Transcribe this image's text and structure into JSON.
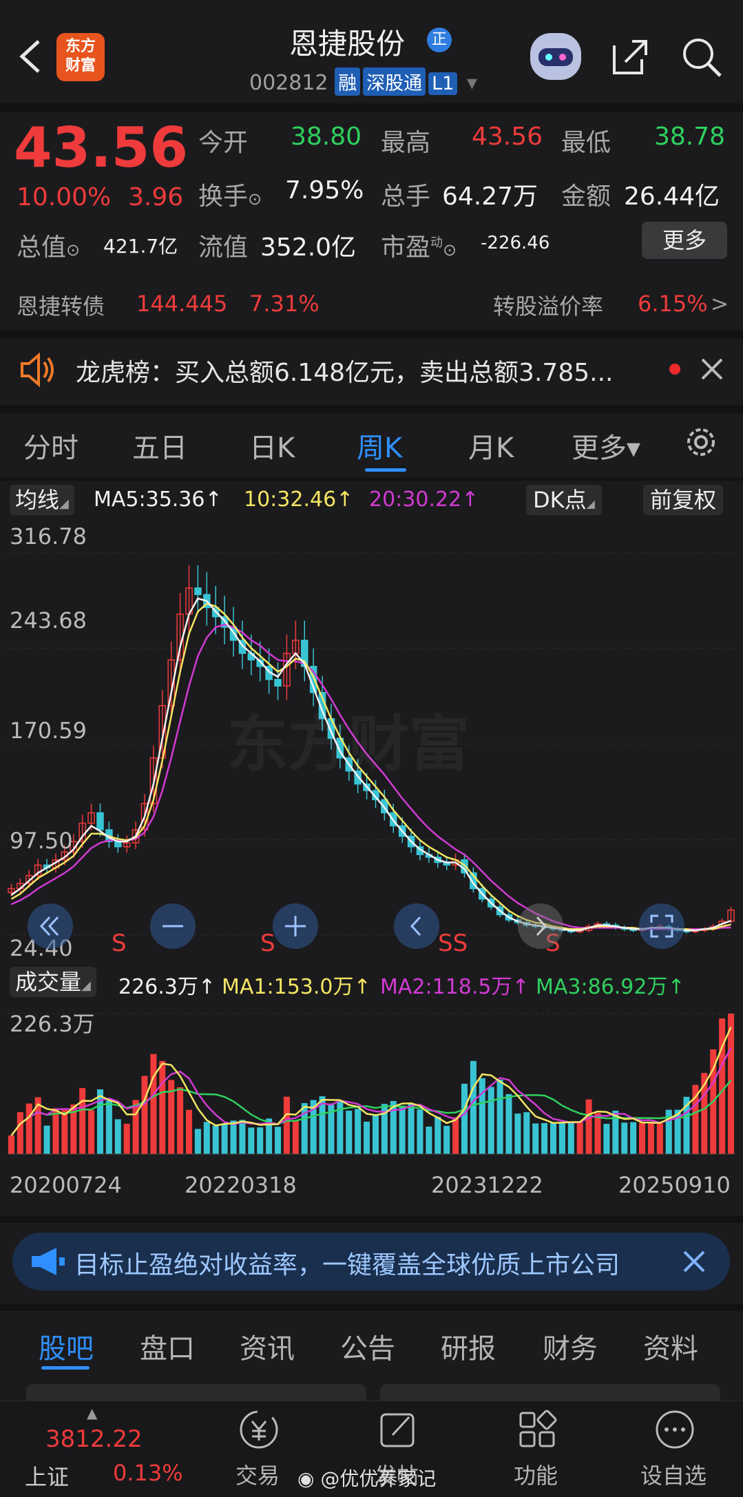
{
  "header": {
    "app_logo_text_1": "东方",
    "app_logo_text_2": "财富",
    "title": "恩捷股份",
    "title_badge": "正",
    "code": "002812",
    "tags": [
      "融",
      "深股通",
      "L1"
    ]
  },
  "quote": {
    "price": "43.56",
    "pct": "10.00%",
    "change": "3.96",
    "open_label": "今开",
    "open": "38.80",
    "high_label": "最高",
    "high": "43.56",
    "low_label": "最低",
    "low": "38.78",
    "turnover_label": "换手",
    "turnover": "7.95%",
    "volume_label": "总手",
    "volume": "64.27万",
    "amount_label": "金额",
    "amount": "26.44亿",
    "mcap_label": "总值",
    "mcap": "421.7亿",
    "float_label": "流值",
    "float_cap": "352.0亿",
    "pe_label": "市盈",
    "pe_sup": "动",
    "pe": "-226.46",
    "more_label": "更多"
  },
  "bond": {
    "name": "恩捷转债",
    "price": "144.445",
    "pct": "7.31%",
    "premium_label": "转股溢价率",
    "premium": "6.15%",
    "arrow": ">"
  },
  "notice": {
    "text": "龙虎榜：买入总额6.148亿元，卖出总额3.785..."
  },
  "chart_tabs": {
    "items": [
      "分时",
      "五日",
      "日K",
      "周K",
      "月K",
      "更多▾"
    ],
    "active": 3
  },
  "ma_bar": {
    "label": "均线",
    "ma5": "MA5:35.36↑",
    "ma10": "10:32.46↑",
    "ma20": "20:30.22↑",
    "dk": "DK点",
    "adj": "前复权"
  },
  "kline": {
    "y_labels": [
      "316.78",
      "243.68",
      "170.59",
      "97.50",
      "24.40"
    ],
    "watermark": "东方财富",
    "signal": "S",
    "signal_double": "SS"
  },
  "vol_bar": {
    "label": "成交量",
    "vol": "226.3万↑",
    "ma1": "MA1:153.0万↑",
    "ma2": "MA2:118.5万↑",
    "ma3": "MA3:86.92万↑",
    "max_label": "226.3万"
  },
  "x_dates": [
    "20200724",
    "20220318",
    "20231222",
    "20250910"
  ],
  "ad": {
    "text": "目标止盈绝对收益率，一键覆盖全球优质上市公司"
  },
  "bottom_tabs": {
    "items": [
      "股吧",
      "盘口",
      "资讯",
      "公告",
      "研报",
      "财务",
      "资料"
    ],
    "active": 0
  },
  "bottom_nav": {
    "index_value": "3812.22",
    "index_name": "上证",
    "index_pct": "0.13%",
    "items": [
      "交易",
      "发帖",
      "功能",
      "设自选"
    ],
    "weibo": "@优优养家记"
  },
  "colors": {
    "up": "#ef3b3b",
    "down": "#39c4d4",
    "ma5": "#f2f2f2",
    "ma10": "#f5e663",
    "ma20": "#d23ad3",
    "accent": "#2f8fff"
  },
  "chart_data": {
    "type": "candlestick",
    "title": "恩捷股份 周K",
    "y_ticks": [
      316.78,
      243.68,
      170.59,
      97.5,
      24.4
    ],
    "ylim": [
      24.4,
      330
    ],
    "x_labels": [
      "20200724",
      "20220318",
      "20231222",
      "20250910"
    ],
    "close": [
      60,
      64,
      70,
      78,
      76,
      82,
      88,
      96,
      110,
      118,
      105,
      96,
      92,
      95,
      105,
      125,
      160,
      200,
      235,
      270,
      290,
      285,
      275,
      268,
      260,
      250,
      240,
      235,
      230,
      220,
      215,
      240,
      250,
      230,
      210,
      190,
      175,
      160,
      150,
      140,
      135,
      128,
      118,
      108,
      100,
      92,
      86,
      84,
      80,
      78,
      82,
      72,
      60,
      52,
      46,
      40,
      36,
      34,
      32,
      31,
      30,
      29,
      28,
      27,
      28,
      31,
      33,
      32,
      30,
      29,
      28,
      29,
      30,
      31,
      29,
      28,
      27,
      28,
      29,
      31,
      35,
      43.56
    ],
    "ma5": [
      55,
      60,
      66,
      72,
      76,
      80,
      84,
      90,
      100,
      108,
      104,
      99,
      96,
      96,
      100,
      115,
      140,
      175,
      210,
      245,
      270,
      282,
      280,
      272,
      265,
      256,
      246,
      240,
      234,
      226,
      222,
      232,
      240,
      232,
      214,
      196,
      180,
      165,
      155,
      146,
      138,
      130,
      122,
      112,
      104,
      96,
      90,
      86,
      82,
      80,
      80,
      75,
      64,
      56,
      49,
      43,
      38,
      35,
      33,
      32,
      31,
      30,
      29,
      28,
      28,
      30,
      32,
      32,
      31,
      30,
      29,
      29,
      30,
      30,
      30,
      29,
      28,
      28,
      29,
      30,
      33,
      35.36
    ],
    "ma10": [
      52,
      56,
      62,
      68,
      72,
      76,
      80,
      85,
      94,
      102,
      102,
      100,
      98,
      97,
      99,
      108,
      128,
      158,
      192,
      226,
      255,
      272,
      278,
      276,
      270,
      262,
      252,
      244,
      238,
      232,
      226,
      230,
      236,
      234,
      222,
      206,
      190,
      176,
      164,
      154,
      146,
      138,
      130,
      120,
      112,
      104,
      97,
      92,
      88,
      84,
      82,
      78,
      70,
      62,
      55,
      49,
      43,
      39,
      36,
      34,
      33,
      31,
      30,
      29,
      29,
      30,
      31,
      31,
      31,
      30,
      30,
      29,
      30,
      30,
      30,
      29,
      29,
      28,
      29,
      29,
      31,
      32.46
    ],
    "ma20": [
      48,
      51,
      55,
      60,
      64,
      68,
      72,
      77,
      84,
      91,
      95,
      97,
      97,
      97,
      98,
      103,
      115,
      135,
      160,
      188,
      215,
      238,
      252,
      260,
      262,
      260,
      256,
      250,
      246,
      240,
      235,
      234,
      234,
      232,
      226,
      216,
      205,
      193,
      182,
      172,
      163,
      155,
      147,
      138,
      129,
      121,
      113,
      106,
      100,
      95,
      90,
      86,
      80,
      73,
      66,
      60,
      54,
      49,
      45,
      41,
      38,
      35,
      33,
      31,
      30,
      30,
      30,
      30,
      30,
      30,
      30,
      29,
      29,
      29,
      29,
      29,
      29,
      29,
      29,
      29,
      30,
      30.22
    ],
    "vol_ma1": 153.0,
    "vol_ma2": 118.5,
    "vol_ma3": 86.92,
    "vol_last": 226.3
  }
}
